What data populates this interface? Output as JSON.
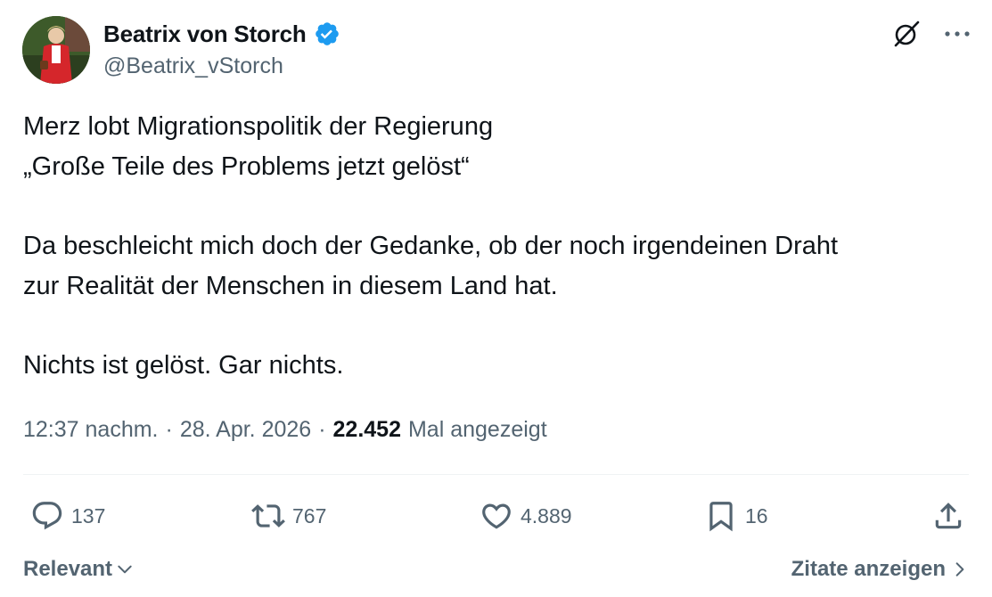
{
  "author": {
    "display_name": "Beatrix von Storch",
    "handle": "@Beatrix_vStorch",
    "verified": true,
    "verified_color": "#1d9bf0"
  },
  "tweet": {
    "paragraphs": [
      "Merz lobt Migrationspolitik der Regierung\n„Große Teile des Problems jetzt gelöst“",
      "Da beschleicht mich doch der Gedanke, ob der noch irgendeinen Draht\nzur Realität der Menschen in diesem Land hat.",
      "Nichts ist gelöst. Gar nichts."
    ]
  },
  "meta": {
    "time": "12:37 nachm.",
    "separator": "·",
    "date": "28. Apr. 2026",
    "views_count": "22.452",
    "views_label": "Mal angezeigt"
  },
  "actions": {
    "replies": "137",
    "reposts": "767",
    "likes": "4.889",
    "bookmarks": "16"
  },
  "footer": {
    "sort_label": "Relevant",
    "quotes_label": "Zitate anzeigen"
  },
  "icons": {
    "grok": "grok-icon",
    "more": "more-icon",
    "reply": "reply-icon",
    "repost": "repost-icon",
    "like": "heart-icon",
    "bookmark": "bookmark-icon",
    "share": "share-icon"
  },
  "colors": {
    "text": "#0f1419",
    "secondary": "#536471",
    "divider": "#eff3f4"
  }
}
